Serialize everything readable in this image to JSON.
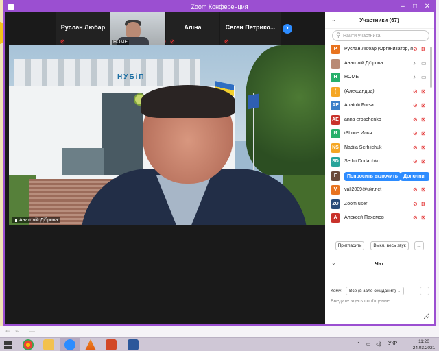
{
  "window": {
    "title": "Zoom Конференция"
  },
  "thumbnails": [
    {
      "name": "Руслан Любар",
      "muted": true
    },
    {
      "name": "HOME",
      "video": true,
      "muted": true
    },
    {
      "name": "Аліна",
      "muted": true
    },
    {
      "name": "Євген Петрико...",
      "muted": true
    }
  ],
  "main_video": {
    "speaker": "Анатолій Діброва",
    "sign_text": "НУБіП"
  },
  "participants_panel": {
    "title": "Участники (67)",
    "search_placeholder": "Найти участника",
    "participants": [
      {
        "initial": "Р",
        "name": "Руслан Любар (Организатор, я)",
        "color": "#e8731f",
        "mic": "muted",
        "cam": "off"
      },
      {
        "initial": "",
        "name": "Анатолій Діброва",
        "color": "#b98a74",
        "mic": "on",
        "cam": "on"
      },
      {
        "initial": "H",
        "name": "HOME",
        "color": "#27b06b",
        "mic": "on",
        "cam": "on"
      },
      {
        "initial": "(",
        "name": "(Александра)",
        "color": "#f5a623",
        "mic": "muted",
        "cam": "off"
      },
      {
        "initial": "AF",
        "name": "Anatolii Fursa",
        "color": "#3a7fc8",
        "mic": "muted",
        "cam": "off"
      },
      {
        "initial": "AE",
        "name": "anna eroschenko",
        "color": "#c8322b",
        "mic": "muted",
        "cam": "off"
      },
      {
        "initial": "И",
        "name": "iPhone Илья",
        "color": "#27b06b",
        "mic": "muted",
        "cam": "off"
      },
      {
        "initial": "NS",
        "name": "Nadiia Serhiichuk",
        "color": "#f5a623",
        "mic": "muted",
        "cam": "off"
      },
      {
        "initial": "SD",
        "name": "Serhii Dodachko",
        "color": "#27a49a",
        "mic": "muted",
        "cam": "off"
      },
      {
        "initial": "F",
        "name": "",
        "color": "#6b4a3a",
        "mic": "",
        "cam": ""
      },
      {
        "initial": "V",
        "name": "vali2009@ukr.net",
        "color": "#e8731f",
        "mic": "muted",
        "cam": "off"
      },
      {
        "initial": "ZU",
        "name": "Zoom user",
        "color": "#2a4d7a",
        "mic": "muted",
        "cam": "off"
      },
      {
        "initial": "A",
        "name": "Алексей Пахомов",
        "color": "#c8322b",
        "mic": "muted",
        "cam": "off"
      }
    ],
    "row_actions": {
      "ask_unmute": "Попросить включить",
      "more": "Дополни"
    },
    "buttons": {
      "invite": "Пригласить",
      "mute_all": "Выкл. весь звук",
      "more": "..."
    }
  },
  "chat": {
    "title": "Чат",
    "to_label": "Кому:",
    "recipient": "Все (в зале ожидания)",
    "more": "...",
    "placeholder": "Введите здесь сообщение..."
  },
  "taskbar": {
    "lang": "УКР",
    "time": "11:20",
    "date": "24.03.2021"
  },
  "colors": {
    "accent": "#9b4fd1",
    "zoom_blue": "#2d8cff",
    "muted_red": "#e02020"
  }
}
